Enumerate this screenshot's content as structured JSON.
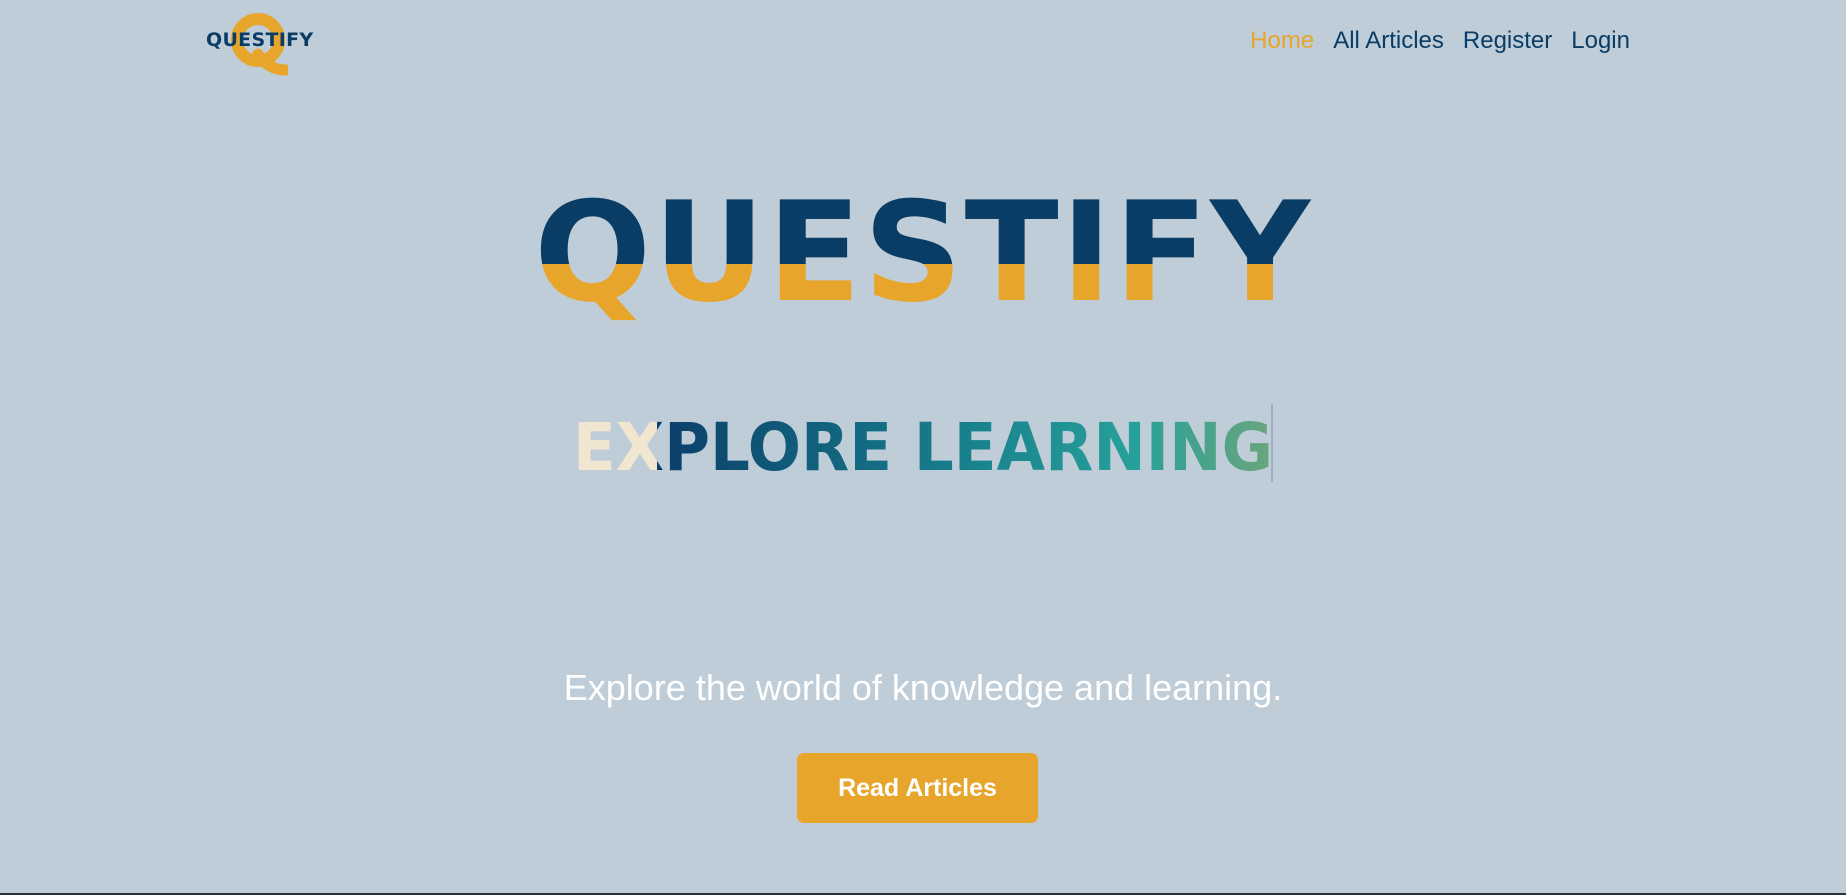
{
  "brand": {
    "logo_text": "QUESTIFY",
    "hero_title": "QUESTIFY",
    "colors": {
      "navy": "#0a3d66",
      "gold": "#e8a52c",
      "background": "#bfcdd8",
      "white": "#ffffff"
    }
  },
  "nav": {
    "items": [
      {
        "label": "Home",
        "active": true
      },
      {
        "label": "All Articles",
        "active": false
      },
      {
        "label": "Register",
        "active": false
      },
      {
        "label": "Login",
        "active": false
      }
    ]
  },
  "hero": {
    "typed_text": "EXPLORE LEARNING",
    "tagline": "Explore the world of knowledge and learning.",
    "cta_label": "Read Articles"
  }
}
